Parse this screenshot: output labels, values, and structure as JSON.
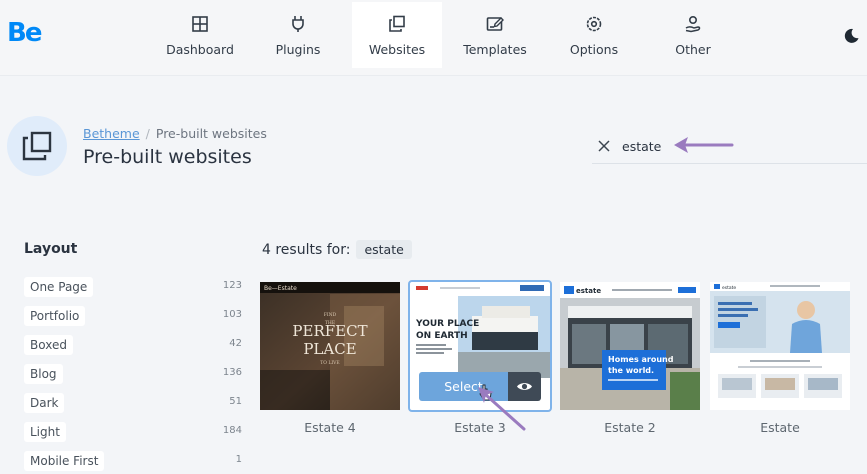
{
  "app": {
    "logo": "Be"
  },
  "nav": [
    {
      "label": "Dashboard",
      "icon": "dashboard-grid-icon"
    },
    {
      "label": "Plugins",
      "icon": "plug-icon"
    },
    {
      "label": "Websites",
      "icon": "websites-stack-icon",
      "active": true
    },
    {
      "label": "Templates",
      "icon": "template-edit-icon"
    },
    {
      "label": "Options",
      "icon": "gear-icon"
    },
    {
      "label": "Other",
      "icon": "user-hand-icon"
    }
  ],
  "theme_toggle": {
    "icon": "moon-icon"
  },
  "breadcrumb": {
    "root": "Betheme",
    "separator": "/",
    "current": "Pre-built websites"
  },
  "page_title": "Pre-built websites",
  "search": {
    "value": "estate",
    "clear_icon": "close-icon"
  },
  "sidebar": {
    "title": "Layout",
    "filters": [
      {
        "label": "One Page",
        "count": "123"
      },
      {
        "label": "Portfolio",
        "count": "103"
      },
      {
        "label": "Boxed",
        "count": "42"
      },
      {
        "label": "Blog",
        "count": "136"
      },
      {
        "label": "Dark",
        "count": "51"
      },
      {
        "label": "Light",
        "count": "184"
      },
      {
        "label": "Mobile First",
        "count": "1"
      }
    ]
  },
  "results": {
    "prefix": "4 results for:",
    "term": "estate"
  },
  "cards": [
    {
      "name": "Estate 4",
      "thumb": {
        "brand": "Be—Estate",
        "small_top": "FIND",
        "small_mid": "THE",
        "headline1": "PERFECT",
        "headline2": "PLACE",
        "small_bottom": "TO LIVE"
      }
    },
    {
      "name": "Estate 3",
      "highlighted": true,
      "thumb": {
        "headline1": "YOUR PLACE",
        "headline2": "ON EARTH"
      },
      "select_label": "Select",
      "preview_icon": "eye-icon"
    },
    {
      "name": "Estate 2",
      "thumb": {
        "brand": "estate",
        "headline1": "Homes around",
        "headline2": "the world."
      }
    },
    {
      "name": "Estate",
      "thumb": {
        "brand": "estate",
        "tagline": "The easiest way to find property"
      }
    }
  ],
  "colors": {
    "accent": "#0089f7",
    "select": "#6da5dc",
    "annotation_arrow": "#9a7bbf"
  }
}
